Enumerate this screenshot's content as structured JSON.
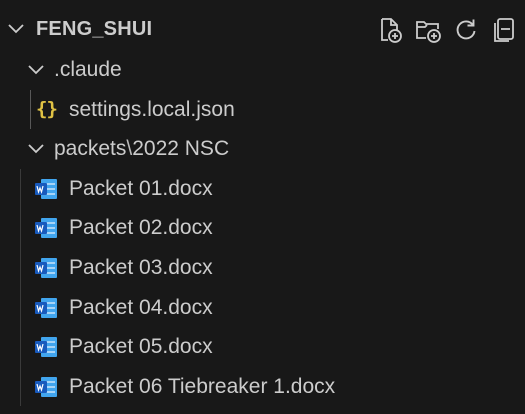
{
  "explorer": {
    "title": "FENG_SHUI",
    "actions": [
      {
        "name": "new-file-icon"
      },
      {
        "name": "new-folder-icon"
      },
      {
        "name": "refresh-icon"
      },
      {
        "name": "collapse-all-icon"
      }
    ]
  },
  "tree": {
    "claude_folder": ".claude",
    "settings_file": "settings.local.json",
    "json_icon_glyph": "{}",
    "packets_folder": "packets",
    "packets_sep": "\\",
    "packets_sub": "2022 NSC",
    "files": [
      "Packet 01.docx",
      "Packet 02.docx",
      "Packet 03.docx",
      "Packet 04.docx",
      "Packet 05.docx",
      "Packet 06 Tiebreaker 1.docx"
    ]
  },
  "colors": {
    "background": "#181818",
    "text": "#cccccc",
    "json": "#e0c244",
    "word": "#2b7cd3"
  }
}
